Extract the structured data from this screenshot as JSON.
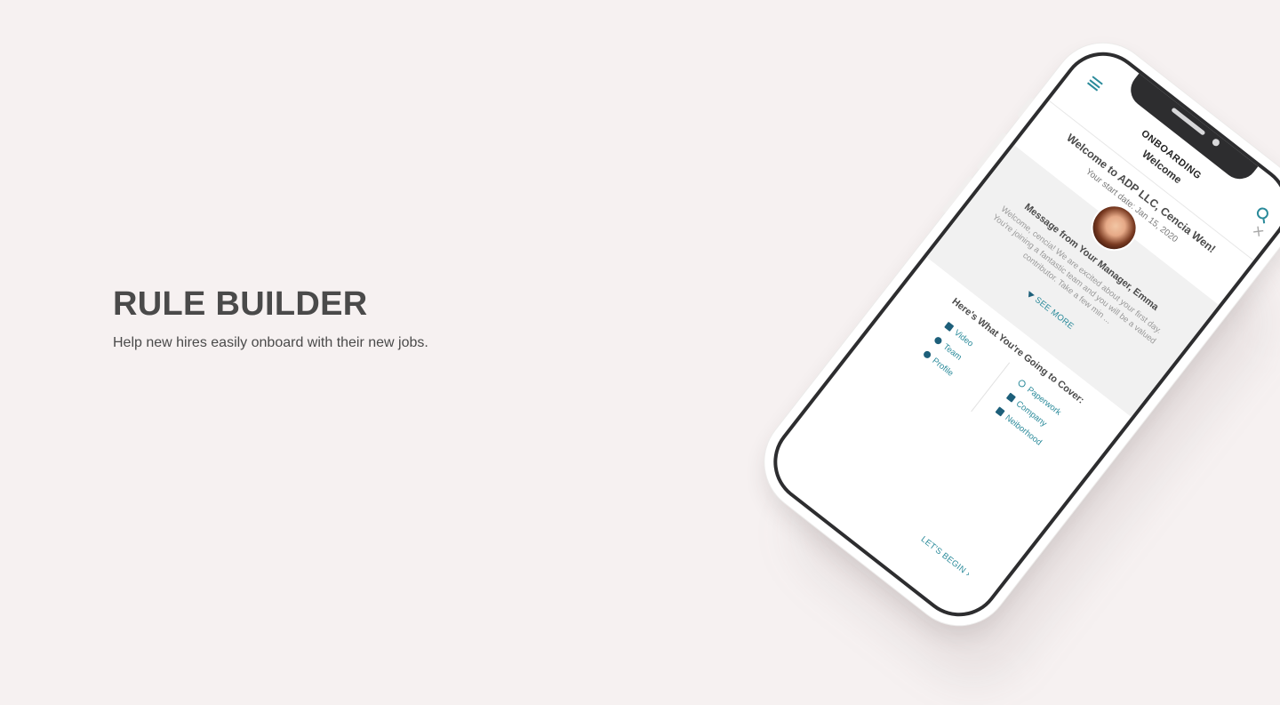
{
  "hero": {
    "title": "RULE BUILDER",
    "subtitle": "Help new hires easily onboard with their new jobs."
  },
  "phone": {
    "app_label": "ONBOARDING",
    "screen_title": "Welcome",
    "welcome_heading": "Welcome to ADP LLC, Cencia Wen!",
    "start_date": "Your start date: Jan 15, 2020",
    "manager_title": "Message from Your Manager, Emma",
    "manager_message": "Welcome, cencia! We are excited about your first day. You're joining a fantastic team and you will be a valued contributor. Take a few min ...",
    "see_more_label": "SEE MORE",
    "topics_heading": "Here's What You're Going to Cover:",
    "topics_left": [
      {
        "label": "Video",
        "icon": "video-icon"
      },
      {
        "label": "Team",
        "icon": "team-icon"
      },
      {
        "label": "Profile",
        "icon": "profile-icon"
      }
    ],
    "topics_right": [
      {
        "label": "Paperwork",
        "icon": "paperwork-icon"
      },
      {
        "label": "Company",
        "icon": "company-icon"
      },
      {
        "label": "Neiborhood",
        "icon": "neighborhood-icon"
      }
    ],
    "lets_begin_label": "LET'S BEGIN ›",
    "accent_color": "#2a8a9a",
    "icon_color": "#1d5f7a"
  }
}
